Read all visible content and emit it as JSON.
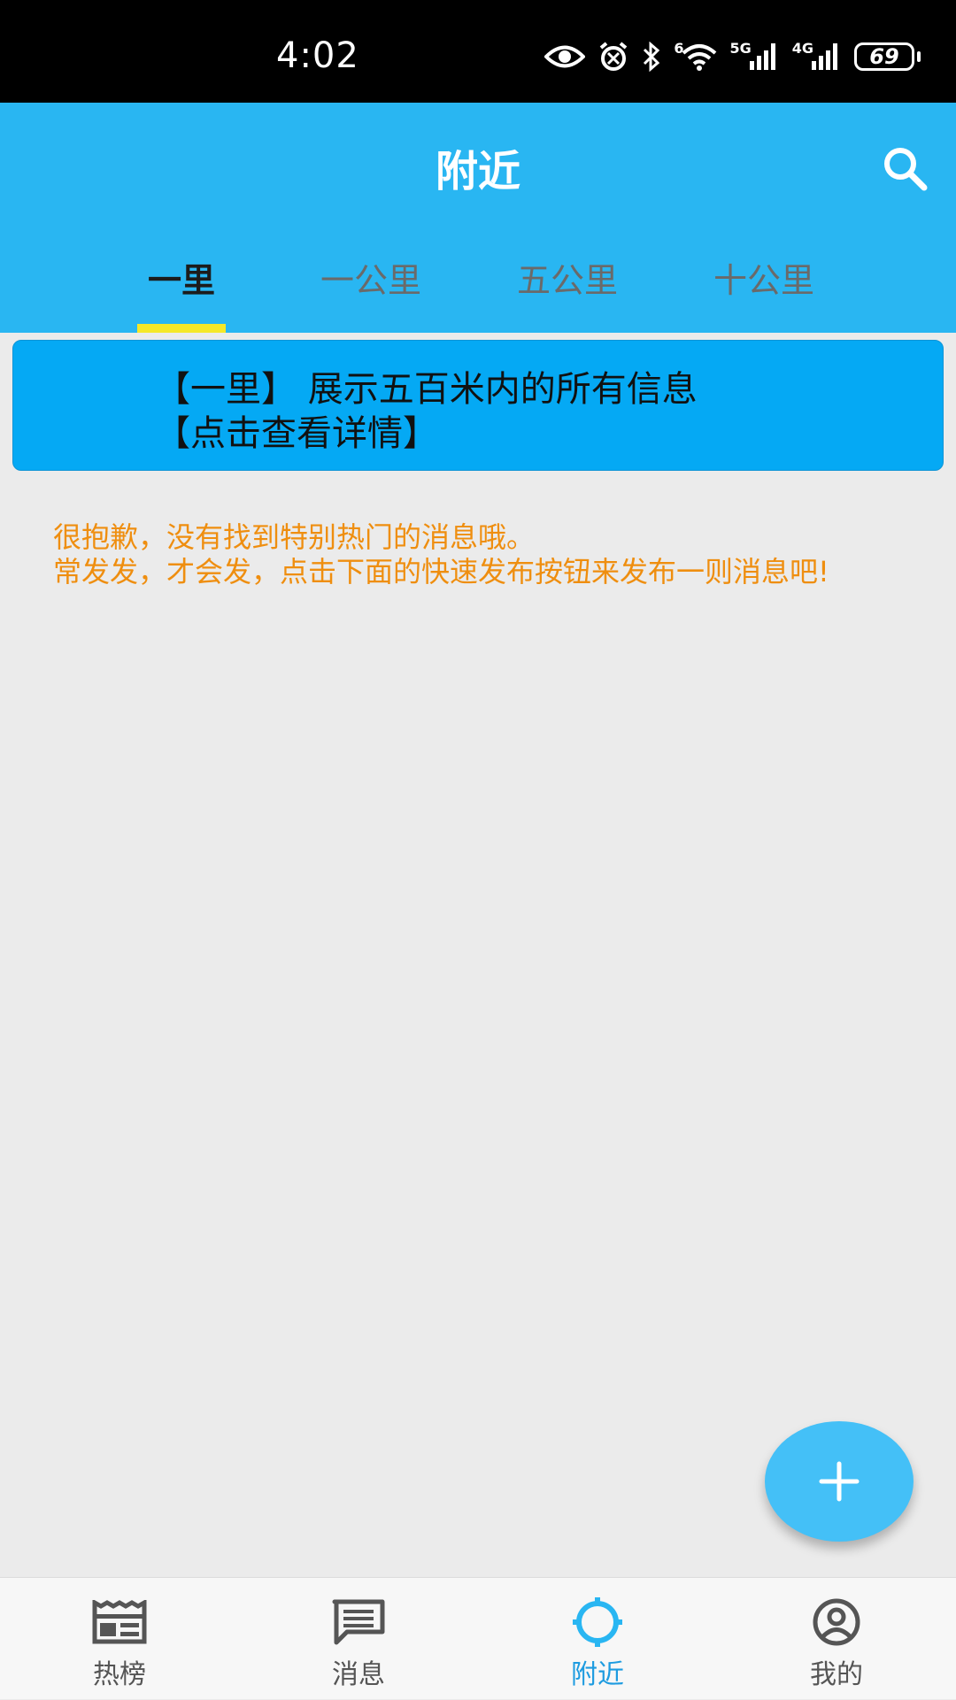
{
  "status_bar": {
    "time": "4:02",
    "battery": "69",
    "signal_labels": [
      "5G",
      "4G"
    ],
    "wifi_badge": "6",
    "icons": [
      "eye-icon",
      "alarm-icon",
      "bluetooth-icon",
      "wifi-icon",
      "signal-5g-icon",
      "signal-4g-icon",
      "battery-icon"
    ]
  },
  "header": {
    "title": "附近",
    "search_icon": "search-icon"
  },
  "tabs": [
    {
      "label": "一里",
      "active": true
    },
    {
      "label": "一公里",
      "active": false
    },
    {
      "label": "五公里",
      "active": false
    },
    {
      "label": "十公里",
      "active": false
    }
  ],
  "banner": {
    "line1": "【一里】 展示五百米内的所有信息",
    "line2": "【点击查看详情】"
  },
  "empty_message": {
    "line1": "很抱歉，没有找到特别热门的消息哦。",
    "line2": "常发发，才会发，点击下面的快速发布按钮来发布一则消息吧!"
  },
  "fab": {
    "icon": "plus-icon"
  },
  "bottom_nav": [
    {
      "label": "热榜",
      "icon": "hot-list-icon",
      "active": false
    },
    {
      "label": "消息",
      "icon": "message-icon",
      "active": false
    },
    {
      "label": "附近",
      "icon": "nearby-icon",
      "active": true
    },
    {
      "label": "我的",
      "icon": "profile-icon",
      "active": false
    }
  ],
  "colors": {
    "header_bg": "#29b6f2",
    "banner_bg": "#05a9f4",
    "tab_indicator": "#f5e829",
    "empty_text": "#ef8e0f",
    "fab_bg": "#44c0f7",
    "nav_active": "#1d9be0"
  }
}
